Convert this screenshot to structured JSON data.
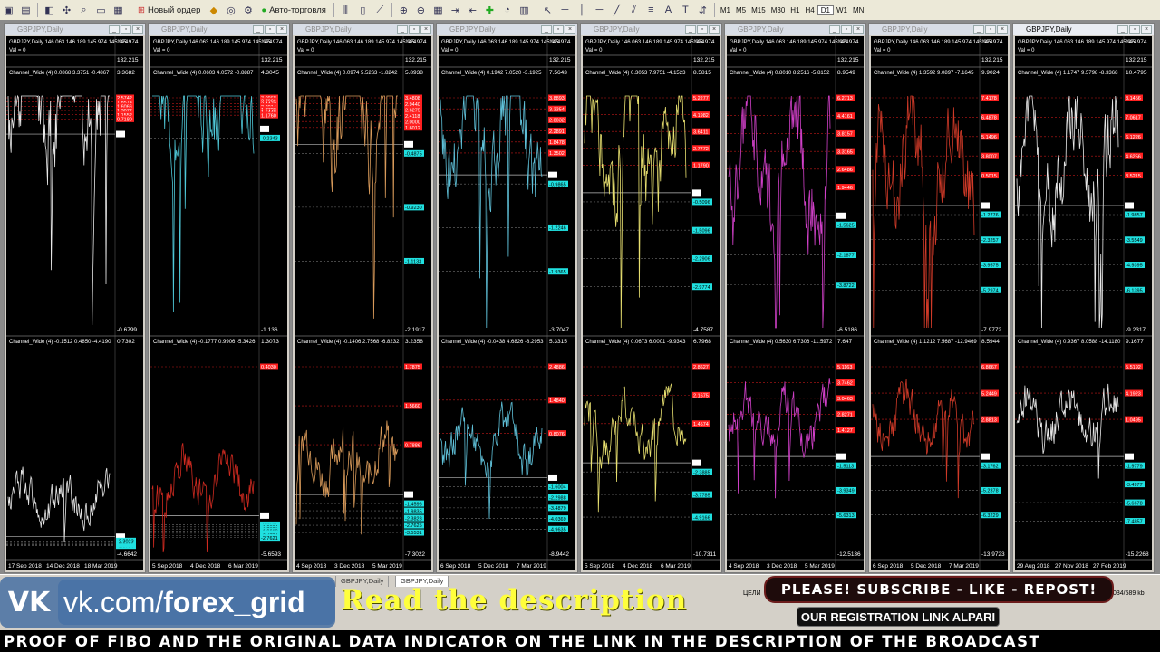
{
  "toolbar": {
    "new_order_label": "Новый ордер",
    "autotrade_label": "Авто-торговля",
    "timeframes": [
      {
        "label": "M1",
        "active": false
      },
      {
        "label": "M5",
        "active": false
      },
      {
        "label": "M15",
        "active": false
      },
      {
        "label": "M30",
        "active": false
      },
      {
        "label": "H1",
        "active": false
      },
      {
        "label": "H4",
        "active": false
      },
      {
        "label": "D1",
        "active": true
      },
      {
        "label": "W1",
        "active": false
      },
      {
        "label": "MN",
        "active": false
      }
    ]
  },
  "colors": {
    "background": "#000000",
    "red_level": "#ff2020",
    "cyan_level": "#20e0e0",
    "level_text_red": "#ffffff",
    "level_text_cyan": "#000000"
  },
  "charts": [
    {
      "title": "GBPJPY,Daily",
      "ohlc": "GBPJPY,Daily 146.063 146.189 145.974 145.974",
      "val": "Val = 0",
      "price_top": "145.974",
      "price_sub": "132.215",
      "line_color": "#e8e8e8",
      "indicator_color2": "#e8e8e8",
      "active": false,
      "top": {
        "label": "Channel_Wide (4) 0.0868 3.3751 -0.4867",
        "scale_top": "3.3682",
        "scale_bottom": "-0.6799",
        "seed": 11,
        "zero_level": 0.78,
        "amp": 0.55,
        "red_levels": [
          "2.5742",
          "1.8574",
          "1.6066",
          "1.3072",
          "1.1552",
          "0.7180"
        ],
        "cyan_levels": []
      },
      "bottom": {
        "label": "Channel_Wide (4) -0.1512 0.4850 -4.4190",
        "scale_top": "0.7302",
        "scale_bottom": "-4.6642",
        "seed": 12,
        "zero_level": 0.1,
        "amp": 0.22,
        "red_levels": [],
        "cyan_levels": [
          "-1.0794",
          "-1.3240",
          "-1.7275",
          "-2.1189",
          "-2.3023"
        ]
      },
      "dates": [
        "17 Sep 2018",
        "14 Dec 2018",
        "18 Mar 2019"
      ]
    },
    {
      "title": "GBPJPY,Daily",
      "ohlc": "GBPJPY,Daily 146.063 146.189 145.974 145.974",
      "val": "Val = 0",
      "price_top": "145.974",
      "price_sub": "132.215",
      "line_color": "#4fc8d8",
      "indicator_color2": "#d02a20",
      "active": false,
      "top": {
        "label": "Channel_Wide (4) 0.0603 4.0572 -0.8887",
        "scale_top": "4.3045",
        "scale_bottom": "-1.136",
        "seed": 21,
        "zero_level": 0.8,
        "amp": 0.5,
        "red_levels": [
          "3.0968",
          "2.7096",
          "2.4472",
          "2.2014",
          "1.7728",
          "1.5448",
          "1.1760"
        ],
        "cyan_levels": [
          "-0.2343"
        ]
      },
      "bottom": {
        "label": "Channel_Wide (4) -0.1777 0.9906 -5.3426",
        "scale_top": "1.3073",
        "scale_bottom": "-5.6593",
        "seed": 22,
        "zero_level": 0.2,
        "amp": 0.24,
        "red_levels": [
          "0.4030"
        ],
        "cyan_levels": [
          "-0.9535",
          "-1.2884",
          "-1.7071",
          "-1.9618",
          "-2.3267",
          "-2.4774",
          "-2.7621"
        ]
      },
      "dates": [
        "5 Sep 2018",
        "4 Dec 2018",
        "6 Mar 2019"
      ]
    },
    {
      "title": "GBPJPY,Daily",
      "ohlc": "GBPJPY,Daily 146.063 146.189 145.974 145.974",
      "val": "Val = 0",
      "price_top": "145.974",
      "price_sub": "132.215",
      "line_color": "#d89a5a",
      "indicator_color2": "#d89a5a",
      "active": false,
      "top": {
        "label": "Channel_Wide (4) 0.0974 5.5263 -1.8242",
        "scale_top": "5.8938",
        "scale_bottom": "-2.1917",
        "seed": 31,
        "zero_level": 0.74,
        "amp": 0.52,
        "red_levels": [
          "3.4808",
          "2.9440",
          "2.6275",
          "2.4118",
          "2.0000",
          "1.6012"
        ],
        "cyan_levels": [
          "-0.4875",
          "-0.9230",
          "-1.1133"
        ]
      },
      "bottom": {
        "label": "Channel_Wide (4) -0.1406 2.7568 -6.8232",
        "scale_top": "3.2358",
        "scale_bottom": "-7.3022",
        "seed": 32,
        "zero_level": 0.3,
        "amp": 0.28,
        "red_levels": [
          "1.7875",
          "1.5660",
          "0.7886"
        ],
        "cyan_levels": [
          "-1.4596",
          "-1.9835",
          "-2.3828",
          "-2.7625",
          "-3.5531"
        ]
      },
      "dates": [
        "4 Sep 2018",
        "3 Dec 2018",
        "5 Mar 2019"
      ]
    },
    {
      "title": "GBPJPY,Daily",
      "ohlc": "GBPJPY,Daily 146.063 146.189 145.974 145.974",
      "val": "Val = 0",
      "price_top": "145.974",
      "price_sub": "132.215",
      "line_color": "#5fc0d8",
      "indicator_color2": "#5fc0d8",
      "active": false,
      "top": {
        "label": "Channel_Wide (4) 0.1942 7.0520 -3.1925",
        "scale_top": "7.5643",
        "scale_bottom": "-3.7047",
        "seed": 41,
        "zero_level": 0.62,
        "amp": 0.48,
        "red_levels": [
          "3.8893",
          "3.3354",
          "2.8032",
          "2.2891",
          "1.8478",
          "1.3502"
        ],
        "cyan_levels": [
          "-0.9865",
          "-1.2246",
          "-1.9365"
        ]
      },
      "bottom": {
        "label": "Channel_Wide (4) -0.0438 4.6826 -8.2953",
        "scale_top": "5.3315",
        "scale_bottom": "-8.9442",
        "seed": 42,
        "zero_level": 0.38,
        "amp": 0.26,
        "red_levels": [
          "2.4886",
          "1.4840",
          "0.8076"
        ],
        "cyan_levels": [
          "-1.6004",
          "-2.2988",
          "-3.4879",
          "-4.0369",
          "-4.9635"
        ]
      },
      "dates": [
        "6 Sep 2018",
        "5 Dec 2018",
        "7 Mar 2019"
      ]
    },
    {
      "title": "GBPJPY,Daily",
      "ohlc": "GBPJPY,Daily 146.063 146.189 145.974 145.974",
      "val": "Val = 0",
      "price_top": "145.974",
      "price_sub": "132.215",
      "line_color": "#e8e070",
      "indicator_color2": "#e8e070",
      "active": false,
      "top": {
        "label": "Channel_Wide (4) 0.3053 7.9751 -4.1523",
        "scale_top": "8.5815",
        "scale_bottom": "-4.7587",
        "seed": 51,
        "zero_level": 0.55,
        "amp": 0.5,
        "red_levels": [
          "5.2277",
          "4.1982",
          "3.6411",
          "2.7772",
          "1.1790"
        ],
        "cyan_levels": [
          "-0.5096",
          "-1.5096",
          "-2.2906",
          "-2.9774"
        ]
      },
      "bottom": {
        "label": "Channel_Wide (4) 0.0673 6.0001 -9.9343",
        "scale_top": "6.7968",
        "scale_bottom": "-10.7311",
        "seed": 52,
        "zero_level": 0.45,
        "amp": 0.26,
        "red_levels": [
          "2.8627",
          "2.1675",
          "1.4574"
        ],
        "cyan_levels": [
          "-2.3885",
          "-3.7785",
          "-4.9166"
        ]
      },
      "dates": [
        "5 Sep 2018",
        "4 Dec 2018",
        "6 Mar 2019"
      ]
    },
    {
      "title": "GBPJPY,Daily",
      "ohlc": "GBPJPY,Daily 146.063 146.189 145.974 145.974",
      "val": "Val = 0",
      "price_top": "145.974",
      "price_sub": "132.215",
      "line_color": "#d040c8",
      "indicator_color2": "#d040c8",
      "active": false,
      "top": {
        "label": "Channel_Wide (4) 0.8010 8.2516 -5.8152",
        "scale_top": "8.9549",
        "scale_bottom": "-6.5186",
        "seed": 61,
        "zero_level": 0.46,
        "amp": 0.52,
        "red_levels": [
          "6.2713",
          "4.4161",
          "3.8157",
          "3.3165",
          "2.6486",
          "1.9446"
        ],
        "cyan_levels": [
          "-1.5625",
          "-2.1877",
          "-3.8722"
        ]
      },
      "bottom": {
        "label": "Channel_Wide (4) 0.5630 6.7306 -11.5972",
        "scale_top": "7.647",
        "scale_bottom": "-12.5136",
        "seed": 62,
        "zero_level": 0.48,
        "amp": 0.26,
        "red_levels": [
          "5.1163",
          "3.7462",
          "3.0463",
          "2.8271",
          "1.4127"
        ],
        "cyan_levels": [
          "-1.5113",
          "-3.9349",
          "-5.6313"
        ]
      },
      "dates": [
        "4 Sep 2018",
        "3 Dec 2018",
        "5 Mar 2019"
      ]
    },
    {
      "title": "GBPJPY,Daily",
      "ohlc": "GBPJPY,Daily 146.063 146.189 145.974 145.974",
      "val": "Val = 0",
      "price_top": "145.974",
      "price_sub": "132.215",
      "line_color": "#d03a28",
      "indicator_color2": "#d03a28",
      "active": false,
      "top": {
        "label": "Channel_Wide (4) 1.3592 9.0897 -7.1645",
        "scale_top": "9.9024",
        "scale_bottom": "-7.9772",
        "seed": 71,
        "zero_level": 0.5,
        "amp": 0.5,
        "red_levels": [
          "7.4178",
          "6.4878",
          "5.1496",
          "3.8007",
          "0.5015"
        ],
        "cyan_levels": [
          "-1.2776",
          "-2.3257",
          "-3.9575",
          "-5.2974"
        ]
      },
      "bottom": {
        "label": "Channel_Wide (4) 1.1212 7.5687 -12.9469",
        "scale_top": "8.5944",
        "scale_bottom": "-13.9723",
        "seed": 72,
        "zero_level": 0.48,
        "amp": 0.26,
        "red_levels": [
          "6.8667",
          "5.2449",
          "2.8813"
        ],
        "cyan_levels": [
          "-3.1762",
          "-5.2378",
          "-6.3229"
        ]
      },
      "dates": [
        "6 Sep 2018",
        "5 Dec 2018",
        "7 Mar 2019"
      ]
    },
    {
      "title": "GBPJPY,Daily",
      "ohlc": "GBPJPY,Daily 146.063 146.189 145.974 145.974",
      "val": "Val = 0",
      "price_top": "145.974",
      "price_sub": "132.215",
      "line_color": "#e8e8e8",
      "indicator_color2": "#e8e8e8",
      "active": true,
      "top": {
        "label": "Channel_Wide (4) 1.1747 9.5798 -8.3368",
        "scale_top": "10.4795",
        "scale_bottom": "-9.2317",
        "seed": 81,
        "zero_level": 0.5,
        "amp": 0.48,
        "red_levels": [
          "8.1456",
          "7.0617",
          "6.1226",
          "4.6256",
          "3.5215"
        ],
        "cyan_levels": [
          "-1.9857",
          "-3.5549",
          "-4.9395",
          "-6.1395"
        ]
      },
      "bottom": {
        "label": "Channel_Wide (4) 0.9367 8.0588 -14.1180",
        "scale_top": "9.1677",
        "scale_bottom": "-15.2268",
        "seed": 82,
        "zero_level": 0.48,
        "amp": 0.26,
        "red_levels": [
          "5.5192",
          "4.1923",
          "1.0495"
        ],
        "cyan_levels": [
          "-1.9779",
          "-3.4977",
          "-5.6678",
          "-7.4857"
        ]
      },
      "dates": [
        "29 Aug 2018",
        "27 Nov 2018",
        "27 Feb 2019"
      ]
    }
  ],
  "tabs": [
    "GBPJPY,Daily",
    "GBPJPY,Daily",
    "GBPJPY,Daily",
    "GBPJPY,Daily"
  ],
  "status": {
    "left": "ЦЕЛИ",
    "right": "034/589 kb"
  },
  "overlay": {
    "vk_logo": "VK",
    "vk_prefix": "vk.com/",
    "vk_name": "forex_grid",
    "read_desc": "Read the description",
    "subscribe": "PLEASE! SUBSCRIBE - LIKE - REPOST!",
    "reglink": "OUR REGISTRATION LINK ALPARI",
    "proof": "PROOF OF FIBO AND THE ORIGINAL DATA INDICATOR ON THE LINK IN THE DESCRIPTION OF THE BROADCAST"
  }
}
